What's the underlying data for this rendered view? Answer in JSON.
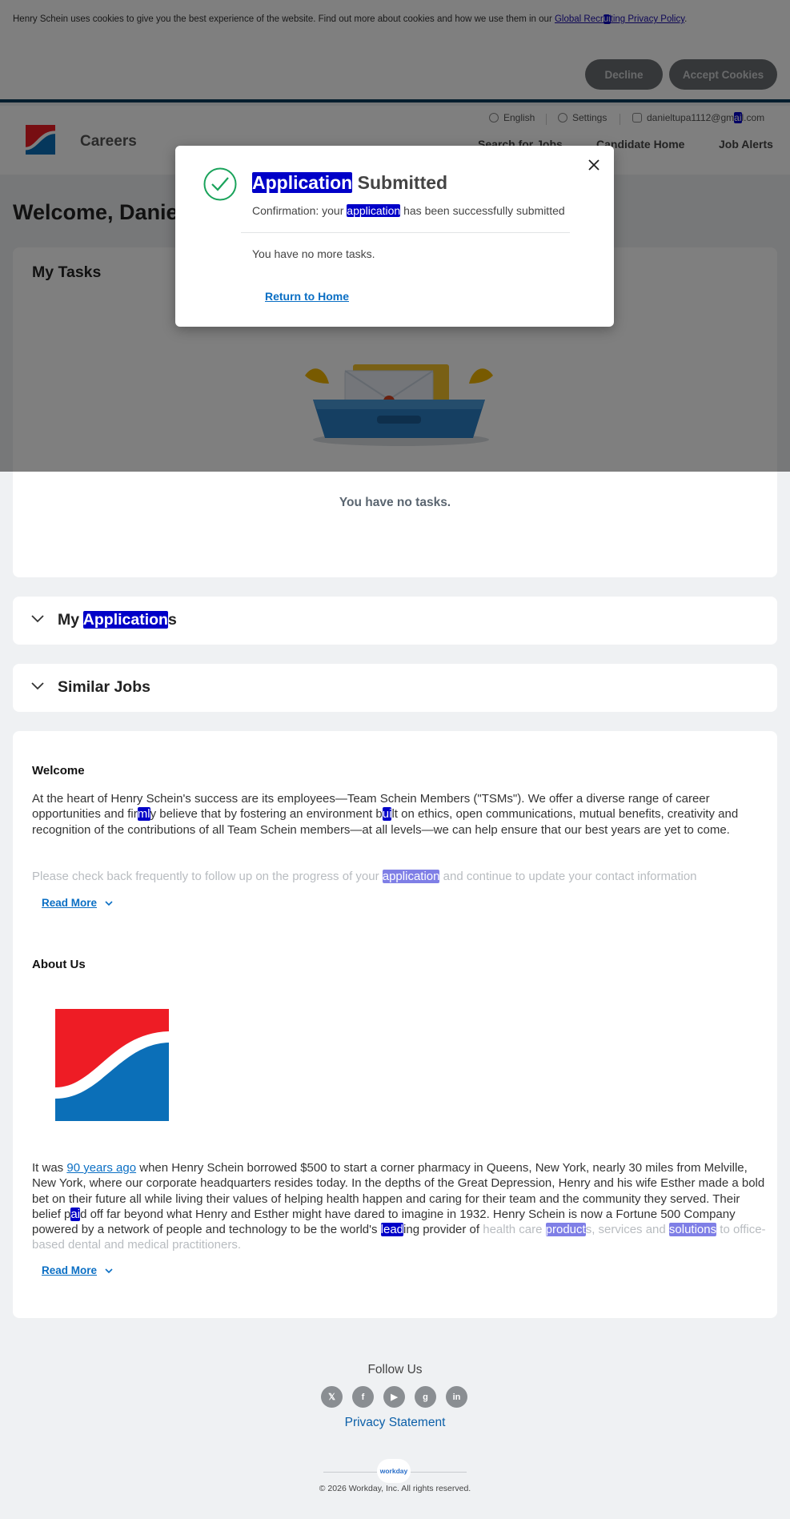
{
  "cookie_banner": {
    "text": "Henry Schein uses cookies to give you the best experience of the website. Find out more about cookies and how we use them in our ",
    "link_pre": "Global Recr",
    "link_hl": "ui",
    "link_post": "ting Privacy Policy",
    "tail": ".",
    "decline": "Decline",
    "accept": "Accept Cookies"
  },
  "header": {
    "site_name": "Careers",
    "language": "English",
    "settings": "Settings",
    "email_pre": "danieltupa1112@gm",
    "email_hl": "ai",
    "email_post": "l.com",
    "nav": [
      "Search for Jobs",
      "Candidate Home",
      "Job Alerts"
    ]
  },
  "welcome": "Welcome, Danie",
  "tasks": {
    "title": "My Tasks",
    "empty": "You have no tasks."
  },
  "accordions": {
    "applications_hl": "Application",
    "applications_pre": "My ",
    "applications_post": "s",
    "similar": "Similar Jobs"
  },
  "welcome_section": {
    "heading": "Welcome",
    "p1_a": "At the heart of Henry Schein's success are its employees—Team Schein Members (\"TSMs\"). We offer a diverse range of career opportunities and fir",
    "p1_hl1": "ml",
    "p1_b": "y believe that by fostering an environment b",
    "p1_hl2": "ui",
    "p1_c": "lt on ethics, open communications, mutual benefits, creativity and recognition of the contributions of all Team Schein members—at all levels—we can help ensure that our best years are yet to come.",
    "p2_a": "Please check back frequently to follow up on the progress of your ",
    "p2_hl": "application",
    "p2_b": " and continue to update your contact information",
    "read_more": "Read More"
  },
  "about_section": {
    "heading": "About Us",
    "p_a": "It was ",
    "p_link": "90 years ago",
    "p_b": " when Henry Schein borrowed $500 to start a corner pharmacy in Queens, New York, nearly 30 miles from Melville, New York, where our corporate headquarters resides today. In the depths of the Great Depression, Henry and his wife Esther made a bold bet on their future all while living their values of helping health happen and caring for their team and the community they served. Their belief p",
    "p_hl1": "ai",
    "p_c": "d off far beyond what Henry and Esther might have dared to imagine in 1932. Henry Schein is now a Fortune 500 Company powered by a network of people and technology to be the world's ",
    "p_hl2": "lead",
    "p_d": "ing provider of ",
    "p_e": "health care ",
    "p_hl3": "product",
    "p_f": "s, services and ",
    "p_hl4": "solutions",
    "p_g": " to office-based dental and medical practitioners.",
    "read_more": "Read More"
  },
  "footer": {
    "follow": "Follow Us",
    "socials": [
      "x-icon",
      "facebook-icon",
      "youtube-icon",
      "glassdoor-icon",
      "linkedin-icon"
    ],
    "privacy": "Privacy Statement",
    "workday": "workday",
    "copyright": "© 2026 Workday, Inc. All rights reserved."
  },
  "modal": {
    "title_hl": "Application",
    "title_rest": " Submitted",
    "sub_pre": "Confirmation: your ",
    "sub_hl": "application",
    "sub_post": " has been successfully submitted",
    "no_more": "You have no more tasks.",
    "return": "Return to Home"
  },
  "colors": {
    "brand_red": "#ee1c25",
    "brand_blue": "#0b6fb8",
    "highlight": "#0000c8",
    "link": "#0b6fc4"
  }
}
